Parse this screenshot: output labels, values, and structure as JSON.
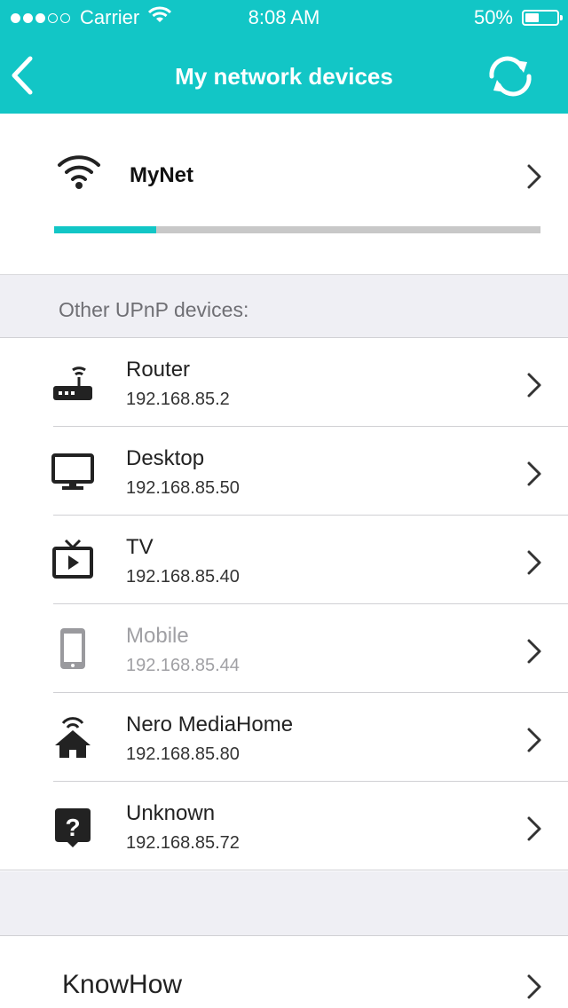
{
  "status_bar": {
    "carrier": "Carrier",
    "time": "8:08 AM",
    "battery": "50%",
    "battery_level": 0.5,
    "signal_bars_filled": 3,
    "signal_bars_total": 5
  },
  "nav": {
    "title": "My network devices",
    "back_icon": "chevron-left-icon",
    "refresh_icon": "refresh-icon"
  },
  "network": {
    "name": "MyNet",
    "icon": "wifi-icon",
    "scan_progress": 0.21
  },
  "section_header": "Other UPnP devices:",
  "devices": [
    {
      "name": "Router",
      "ip": "192.168.85.2",
      "icon": "router-icon",
      "dimmed": false
    },
    {
      "name": "Desktop",
      "ip": "192.168.85.50",
      "icon": "monitor-icon",
      "dimmed": false
    },
    {
      "name": "TV",
      "ip": "192.168.85.40",
      "icon": "tv-icon",
      "dimmed": false
    },
    {
      "name": "Mobile",
      "ip": "192.168.85.44",
      "icon": "mobile-phone-icon",
      "dimmed": true
    },
    {
      "name": "Nero MediaHome",
      "ip": "192.168.85.80",
      "icon": "media-home-icon",
      "dimmed": false
    },
    {
      "name": "Unknown",
      "ip": "192.168.85.72",
      "icon": "question-icon",
      "dimmed": false
    }
  ],
  "footer_item": {
    "label": "KnowHow"
  },
  "colors": {
    "accent": "#12c6c6",
    "section_background": "#efeff4",
    "progress_track": "#c8c8c8",
    "dim_text": "#a0a0a4"
  }
}
